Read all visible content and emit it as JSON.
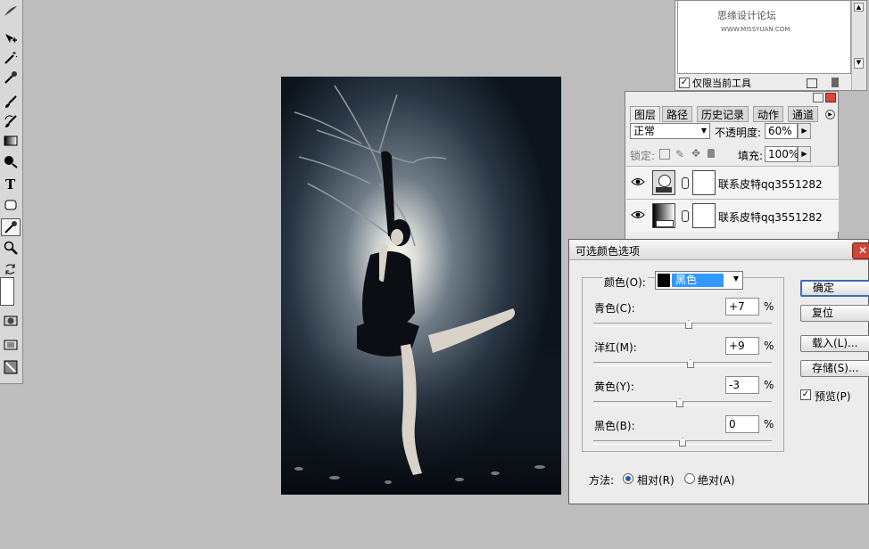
{
  "preset_panel": {
    "watermark": "思缘设计论坛",
    "watermark_url": "WWW.MISSYUAN.COM",
    "current_tool_only": "仅限当前工具"
  },
  "layers_panel": {
    "tabs": [
      "图层",
      "路径",
      "历史记录",
      "动作",
      "通道"
    ],
    "blend_mode": "正常",
    "opacity_label": "不透明度:",
    "opacity_value": "60%",
    "lock_label": "锁定:",
    "fill_label": "填充:",
    "fill_value": "100%",
    "layers": [
      {
        "name": "联系皮特qq3551282"
      },
      {
        "name": "联系皮特qq3551282"
      }
    ]
  },
  "dialog": {
    "title": "可选颜色选项",
    "color_label": "颜色(O):",
    "color_value": "黑色",
    "swatch_color": "#000000",
    "sliders": [
      {
        "label": "青色(C):",
        "value": "+7",
        "unit": "%",
        "fraction": 0.535
      },
      {
        "label": "洋红(M):",
        "value": "+9",
        "unit": "%",
        "fraction": 0.545
      },
      {
        "label": "黄色(Y):",
        "value": "-3",
        "unit": "%",
        "fraction": 0.485
      },
      {
        "label": "黑色(B):",
        "value": "0",
        "unit": "%",
        "fraction": 0.5
      }
    ],
    "buttons": {
      "ok": "确定",
      "reset": "复位",
      "load": "载入(L)...",
      "save": "存储(S)..."
    },
    "preview_label": "预览(P)",
    "method_label": "方法:",
    "method_relative": "相对(R)",
    "method_absolute": "绝对(A)",
    "method_selected": "relative"
  },
  "colors": {
    "accent": "#3b6db4",
    "selection": "#3399ff"
  }
}
